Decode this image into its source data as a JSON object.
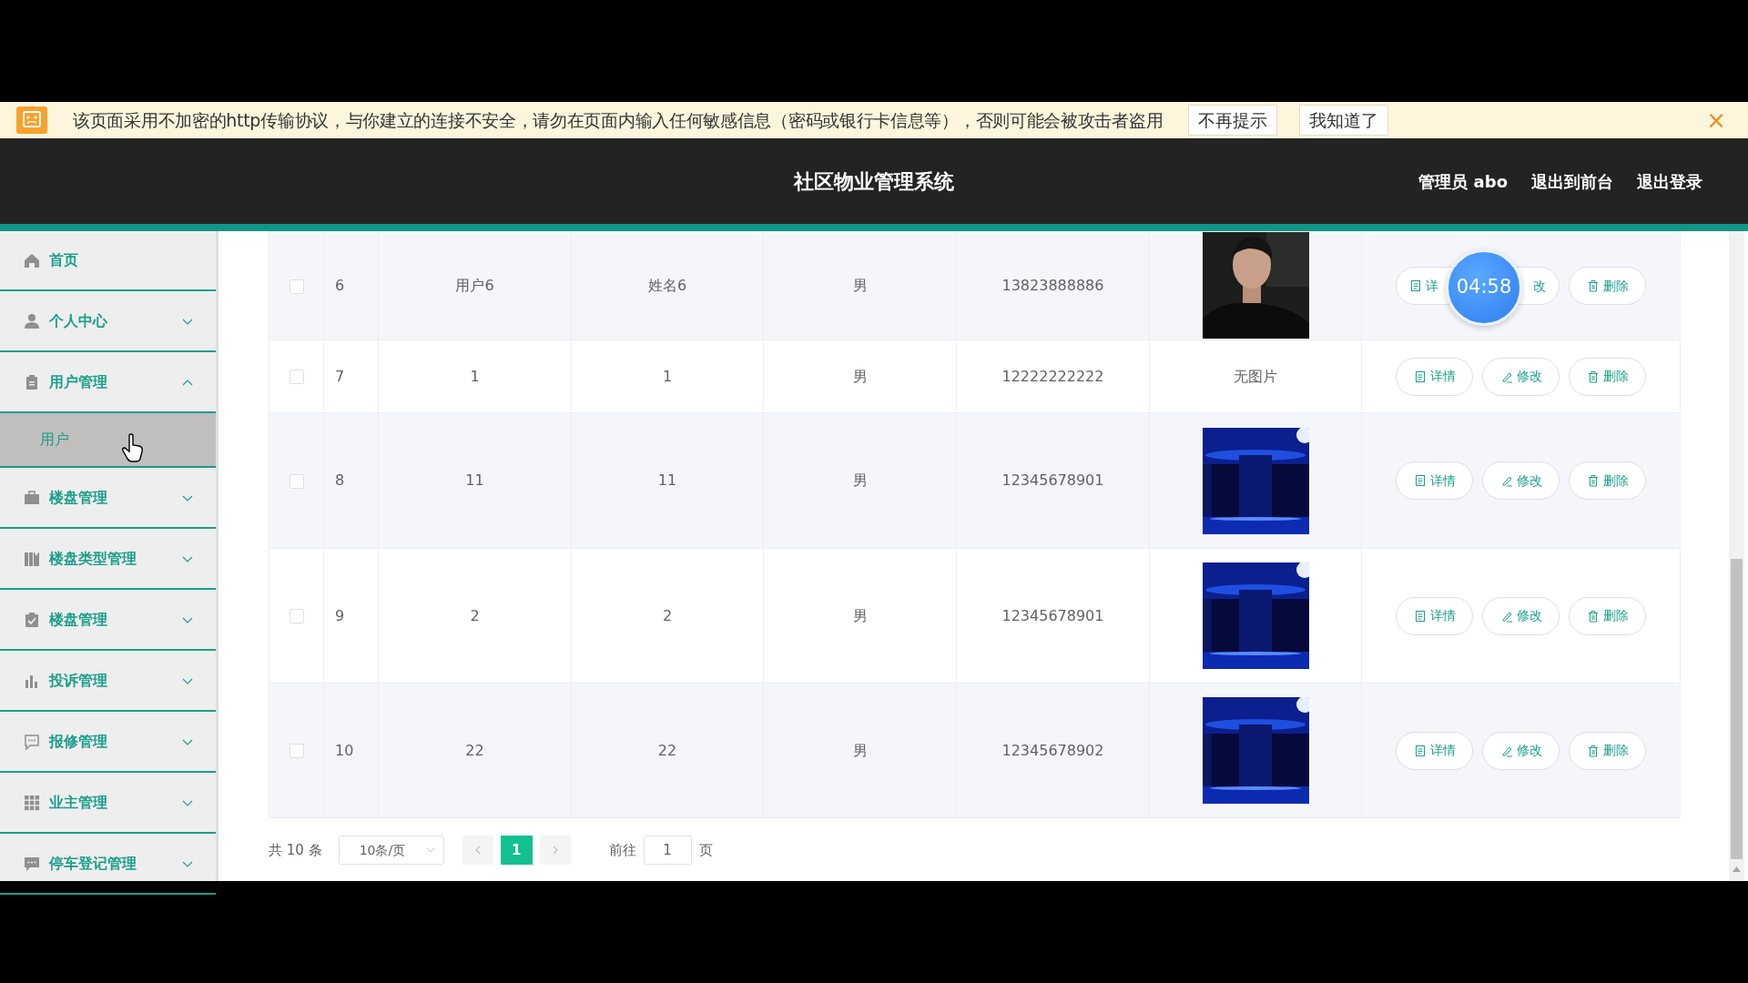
{
  "notice": {
    "text": "该页面采用不加密的http传输协议，与你建立的连接不安全，请勿在页面内输入任何敏感信息（密码或银行卡信息等），否则可能会被攻击者盗用",
    "buttons": [
      "不再提示",
      "我知道了"
    ],
    "close": "×"
  },
  "header": {
    "title": "社区物业管理系统",
    "links": [
      "管理员 abo",
      "退出到前台",
      "退出登录"
    ]
  },
  "sidebar": {
    "items": [
      {
        "kind": "link",
        "label": "首页"
      },
      {
        "kind": "menu",
        "label": "个人中心",
        "expanded": false
      },
      {
        "kind": "menu",
        "label": "用户管理",
        "expanded": true,
        "children": [
          {
            "label": "用户",
            "selected": true
          }
        ]
      },
      {
        "kind": "menu",
        "label": "楼盘管理",
        "expanded": false
      },
      {
        "kind": "menu",
        "label": "楼盘类型管理",
        "expanded": false
      },
      {
        "kind": "menu",
        "label": "楼盘管理",
        "expanded": false
      },
      {
        "kind": "menu",
        "label": "投诉管理",
        "expanded": false
      },
      {
        "kind": "menu",
        "label": "报修管理",
        "expanded": false
      },
      {
        "kind": "menu",
        "label": "业主管理",
        "expanded": false
      },
      {
        "kind": "menu",
        "label": "停车登记管理",
        "expanded": false
      }
    ]
  },
  "table": {
    "rows": [
      {
        "checked": false,
        "index": "6",
        "username": "用户6",
        "name": "姓名6",
        "gender": "男",
        "phone": "13823888886",
        "actions": [
          "详",
          "改",
          "删除"
        ]
      },
      {
        "checked": false,
        "index": "7",
        "username": "1",
        "name": "1",
        "gender": "男",
        "phone": "12222222222",
        "photo": {
          "kind": "text",
          "text": "无图片"
        },
        "actions": [
          "详情",
          "修改",
          "删除"
        ]
      },
      {
        "checked": false,
        "index": "8",
        "username": "11",
        "name": "11",
        "gender": "男",
        "phone": "12345678901",
        "actions": [
          "详情",
          "修改",
          "删除"
        ]
      },
      {
        "checked": false,
        "index": "9",
        "username": "2",
        "name": "2",
        "gender": "男",
        "phone": "12345678901",
        "actions": [
          "详情",
          "修改",
          "删除"
        ]
      },
      {
        "checked": false,
        "index": "10",
        "username": "22",
        "name": "22",
        "gender": "男",
        "phone": "12345678902",
        "actions": [
          "详情",
          "修改",
          "删除"
        ]
      }
    ]
  },
  "pagination": {
    "total": "共 10 条",
    "page_size": "10条/页",
    "pages": [
      {
        "label": "1",
        "selected": true
      }
    ],
    "goto_label": "前往",
    "goto_value": "1",
    "goto_suffix": "页"
  },
  "timer": "04:58"
}
